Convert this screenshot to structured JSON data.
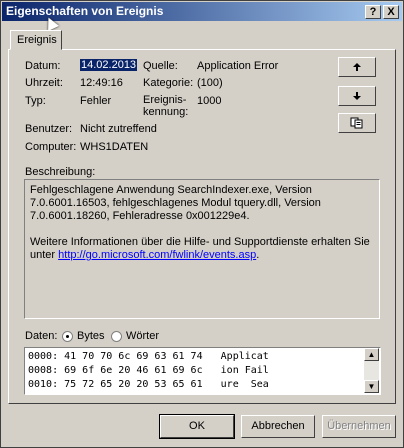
{
  "window": {
    "title": "Eigenschaften von Ereignis"
  },
  "titlebar": {
    "help_label": "?",
    "close_label": "X"
  },
  "tabs": [
    {
      "label": "Ereignis"
    }
  ],
  "event": {
    "date_label": "Datum:",
    "date_value": "14.02.2013",
    "time_label": "Uhrzeit:",
    "time_value": "12:49:16",
    "type_label": "Typ:",
    "type_value": "Fehler",
    "user_label": "Benutzer:",
    "user_value": "Nicht zutreffend",
    "computer_label": "Computer:",
    "computer_value": "WHS1DATEN",
    "source_label": "Quelle:",
    "source_value": "Application Error",
    "category_label": "Kategorie:",
    "category_value": "(100)",
    "event_id_label_1": "Ereignis-",
    "event_id_label_2": "kennung:",
    "event_id_value": "1000"
  },
  "nav": {
    "up_icon": "arrow-up-icon",
    "down_icon": "arrow-down-icon",
    "copy_icon": "copy-icon"
  },
  "description": {
    "label": "Beschreibung:",
    "line1": "Fehlgeschlagene Anwendung SearchIndexer.exe, Version",
    "line2": "7.0.6001.16503, fehlgeschlagenes Modul tquery.dll, Version",
    "line3": "7.0.6001.18260, Fehleradresse 0x001229e4.",
    "line4": "Weitere Informationen über die Hilfe- und Supportdienste erhalten Sie",
    "line5_prefix": "unter ",
    "link": "http://go.microsoft.com/fwlink/events.asp",
    "line5_suffix": "."
  },
  "data": {
    "label": "Daten:",
    "option_bytes": "Bytes",
    "option_words": "Wörter",
    "selected": "Bytes",
    "rows": [
      "0000: 41 70 70 6c 69 63 61 74   Applicat",
      "0008: 69 6f 6e 20 46 61 69 6c   ion Fail",
      "0010: 75 72 65 20 20 53 65 61   ure  Sea"
    ]
  },
  "buttons": {
    "ok": "OK",
    "cancel": "Abbrechen",
    "apply": "Übernehmen"
  }
}
